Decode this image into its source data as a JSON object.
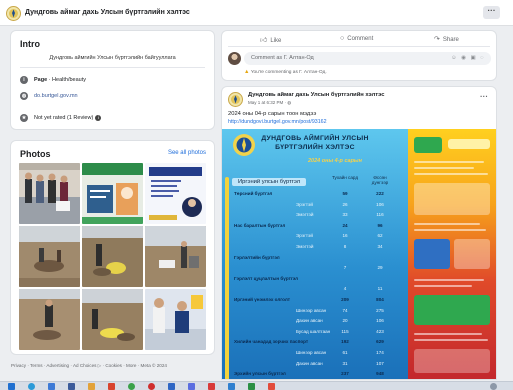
{
  "header": {
    "page_name": "Дундговь аймаг дахь Улсын бүртгэлийн хэлтэс",
    "more_label": "···"
  },
  "intro": {
    "title": "Intro",
    "bio": "Дундговь аймгийн Улсын бүртгэлийн байгууллага",
    "page_category_prefix": "Page",
    "page_category": "· Health/beauty",
    "website": "do.burtgel.gov.mn",
    "rating": "Not yet rated (1 Review)",
    "rating_info": "i"
  },
  "photos": {
    "title": "Photos",
    "see_all": "See all photos"
  },
  "footer": {
    "links": "Privacy · Terms · Advertising · Ad Choices ▷ · Cookies · More · Meta © 2024"
  },
  "prev_post": {
    "like": "Like",
    "comment": "Comment",
    "share": "Share",
    "comment_placeholder": "Comment as Г. Алтан-Од",
    "comment_icons": "☺ ◉ ▣ ◌",
    "commenting_note": "You're commenting as Г. Алтан-Од."
  },
  "post": {
    "author": "Дундговь аймаг дахь Улсын бүртгэлийн хэлтэс",
    "meta": "May 1 at 6:32 PM · ◍",
    "more_label": "···",
    "text": "2024 оны 04-р сарын тоон мэдээ",
    "link": "http://dundgovi.burtgel.gov.mn/post/93162"
  },
  "infographic": {
    "title_line1": "ДУНДГОВЬ АЙМГИЙН УЛСЫН",
    "title_line2": "БҮРТГЭЛИЙН ХЭЛТЭС",
    "subtitle": "2024 оны 4-р сарын",
    "header_label": "Иргэний улсын бүртгэл",
    "col1_header": "Тухайн сард",
    "col2_header": "Өссөн дүнгээр",
    "rows": [
      {
        "label": "Төрсний бүртгэл",
        "v1": "59",
        "v2": "222",
        "kind": "main"
      },
      {
        "label": "Эрэгтэй",
        "v1": "26",
        "v2": "106",
        "kind": "sub"
      },
      {
        "label": "Эмэгтэй",
        "v1": "33",
        "v2": "116",
        "kind": "sub"
      },
      {
        "label": "Нас баралтын бүртгэл",
        "v1": "24",
        "v2": "96",
        "kind": "main"
      },
      {
        "label": "Эрэгтэй",
        "v1": "16",
        "v2": "62",
        "kind": "sub"
      },
      {
        "label": "Эмэгтэй",
        "v1": "8",
        "v2": "34",
        "kind": "sub"
      },
      {
        "label": "Гэрлэлтийн бүртгэл",
        "v1": "",
        "v2": "",
        "kind": "main"
      },
      {
        "label": "",
        "v1": "7",
        "v2": "29",
        "kind": "sub"
      },
      {
        "label": "Гэрлэлт цуцлалтын бүртгэл",
        "v1": "",
        "v2": "",
        "kind": "main"
      },
      {
        "label": "",
        "v1": "4",
        "v2": "11",
        "kind": "sub"
      },
      {
        "label": "Иргэний үнэмлэх олголт",
        "v1": "209",
        "v2": "804",
        "kind": "main"
      },
      {
        "label": "Шинээр авсан",
        "v1": "74",
        "v2": "275",
        "kind": "sub"
      },
      {
        "label": "Дахин авсан",
        "v1": "20",
        "v2": "106",
        "kind": "sub"
      },
      {
        "label": "Бусад шалтгаан",
        "v1": "115",
        "v2": "423",
        "kind": "sub"
      },
      {
        "label": "Хилийн чанадад зорчих паспорт",
        "v1": "192",
        "v2": "629",
        "kind": "main"
      },
      {
        "label": "Шинээр авсан",
        "v1": "61",
        "v2": "174",
        "kind": "sub"
      },
      {
        "label": "Дахин авсан",
        "v1": "31",
        "v2": "107",
        "kind": "sub"
      },
      {
        "label": "Эрхийн улсын бүртгэл",
        "v1": "237",
        "v2": "948",
        "kind": "main"
      }
    ]
  }
}
